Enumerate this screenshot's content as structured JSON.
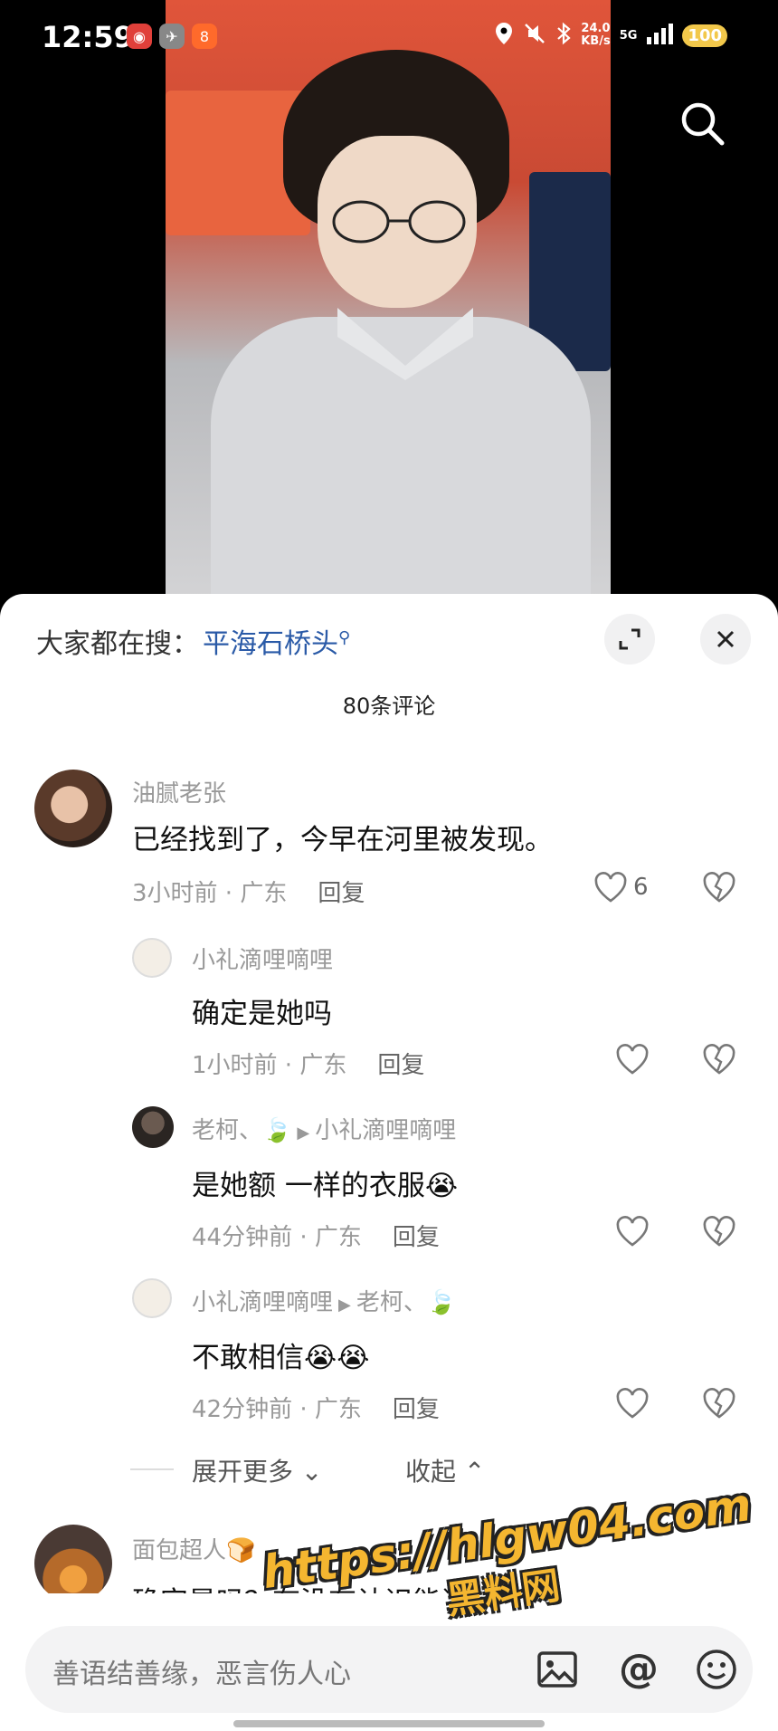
{
  "status": {
    "time": "12:59",
    "net_speed_value": "24.0",
    "net_speed_unit": "KB/s",
    "signal": "5G",
    "battery": "100"
  },
  "sheet": {
    "search_prefix": "大家都在搜：",
    "search_term": "平海石桥头",
    "comment_count": "80条评论"
  },
  "comments": [
    {
      "user": "油腻老张",
      "text": "已经找到了，今早在河里被发现。",
      "time": "3小时前 · 广东",
      "reply": "回复",
      "likes": "6"
    },
    {
      "user": "小礼滴哩嘀哩",
      "text": "确定是她吗",
      "time": "1小时前 · 广东",
      "reply": "回复"
    },
    {
      "user": "老柯、🍃",
      "reply_to": "小礼滴哩嘀哩",
      "text": "是她额  一样的衣服😭",
      "time": "44分钟前 · 广东",
      "reply": "回复"
    },
    {
      "user": "小礼滴哩嘀哩",
      "reply_to": "老柯、🍃",
      "text": "不敢相信😭😭",
      "time": "42分钟前 · 广东",
      "reply": "回复"
    },
    {
      "user": "面包超人🍞",
      "text": "确定是吗？有没有认识能说一下？"
    }
  ],
  "thread_controls": {
    "expand_more": "展开更多",
    "collapse": "收起"
  },
  "watermark": {
    "url": "https://hlgw04.com",
    "brand": "黑料网"
  },
  "input": {
    "placeholder": "善语结善缘，恶言伤人心"
  },
  "icons": [
    "search-icon",
    "expand-icon",
    "close-icon",
    "heart-icon",
    "broken-heart-icon",
    "image-icon",
    "at-icon",
    "emoji-icon"
  ]
}
